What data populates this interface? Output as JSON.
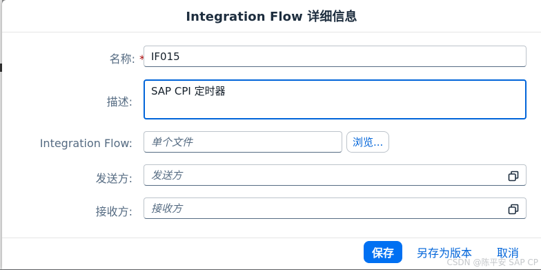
{
  "dialog": {
    "title": "Integration Flow 详细信息"
  },
  "form": {
    "name": {
      "label": "名称:",
      "required_mark": "*",
      "value": "IF015"
    },
    "description": {
      "label": "描述:",
      "value": "SAP CPI 定时器"
    },
    "integration_flow": {
      "label": "Integration Flow:",
      "placeholder": "单个文件",
      "browse_label": "浏览..."
    },
    "sender": {
      "label": "发送方:",
      "placeholder": "发送方",
      "value_help_icon": "value-help-icon"
    },
    "receiver": {
      "label": "接收方:",
      "placeholder": "接收方",
      "value_help_icon": "value-help-icon"
    }
  },
  "footer": {
    "save_label": "保存",
    "save_as_version_label": "另存为版本",
    "cancel_label": "取消"
  },
  "watermark": "CSDN @陈平安 SAP CP",
  "colors": {
    "accent": "#0070f2",
    "link": "#0064d9",
    "label": "#556b82",
    "required": "#aa0808"
  }
}
